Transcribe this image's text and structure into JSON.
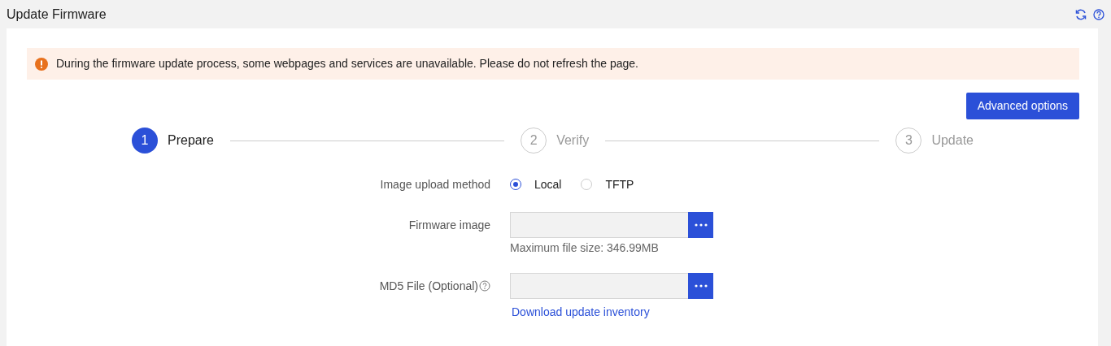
{
  "page": {
    "title": "Update Firmware"
  },
  "alert": {
    "text": "During the firmware update process, some webpages and services are unavailable. Please do not refresh the page."
  },
  "advanced_button": "Advanced options",
  "steps": [
    {
      "number": "1",
      "label": "Prepare",
      "selected": true
    },
    {
      "number": "2",
      "label": "Verify",
      "selected": false
    },
    {
      "number": "3",
      "label": "Update",
      "selected": false
    }
  ],
  "form": [
    {
      "kind": "radio",
      "label": "Image upload method",
      "options": [
        {
          "label": "Local",
          "selected": true
        },
        {
          "label": "TFTP",
          "selected": false
        }
      ]
    },
    {
      "kind": "file",
      "label": "Firmware image",
      "help": false,
      "hint": "Maximum file size: 346.99MB"
    },
    {
      "kind": "file",
      "label": "MD5 File (Optional)",
      "help": true,
      "link": "Download update inventory"
    }
  ]
}
